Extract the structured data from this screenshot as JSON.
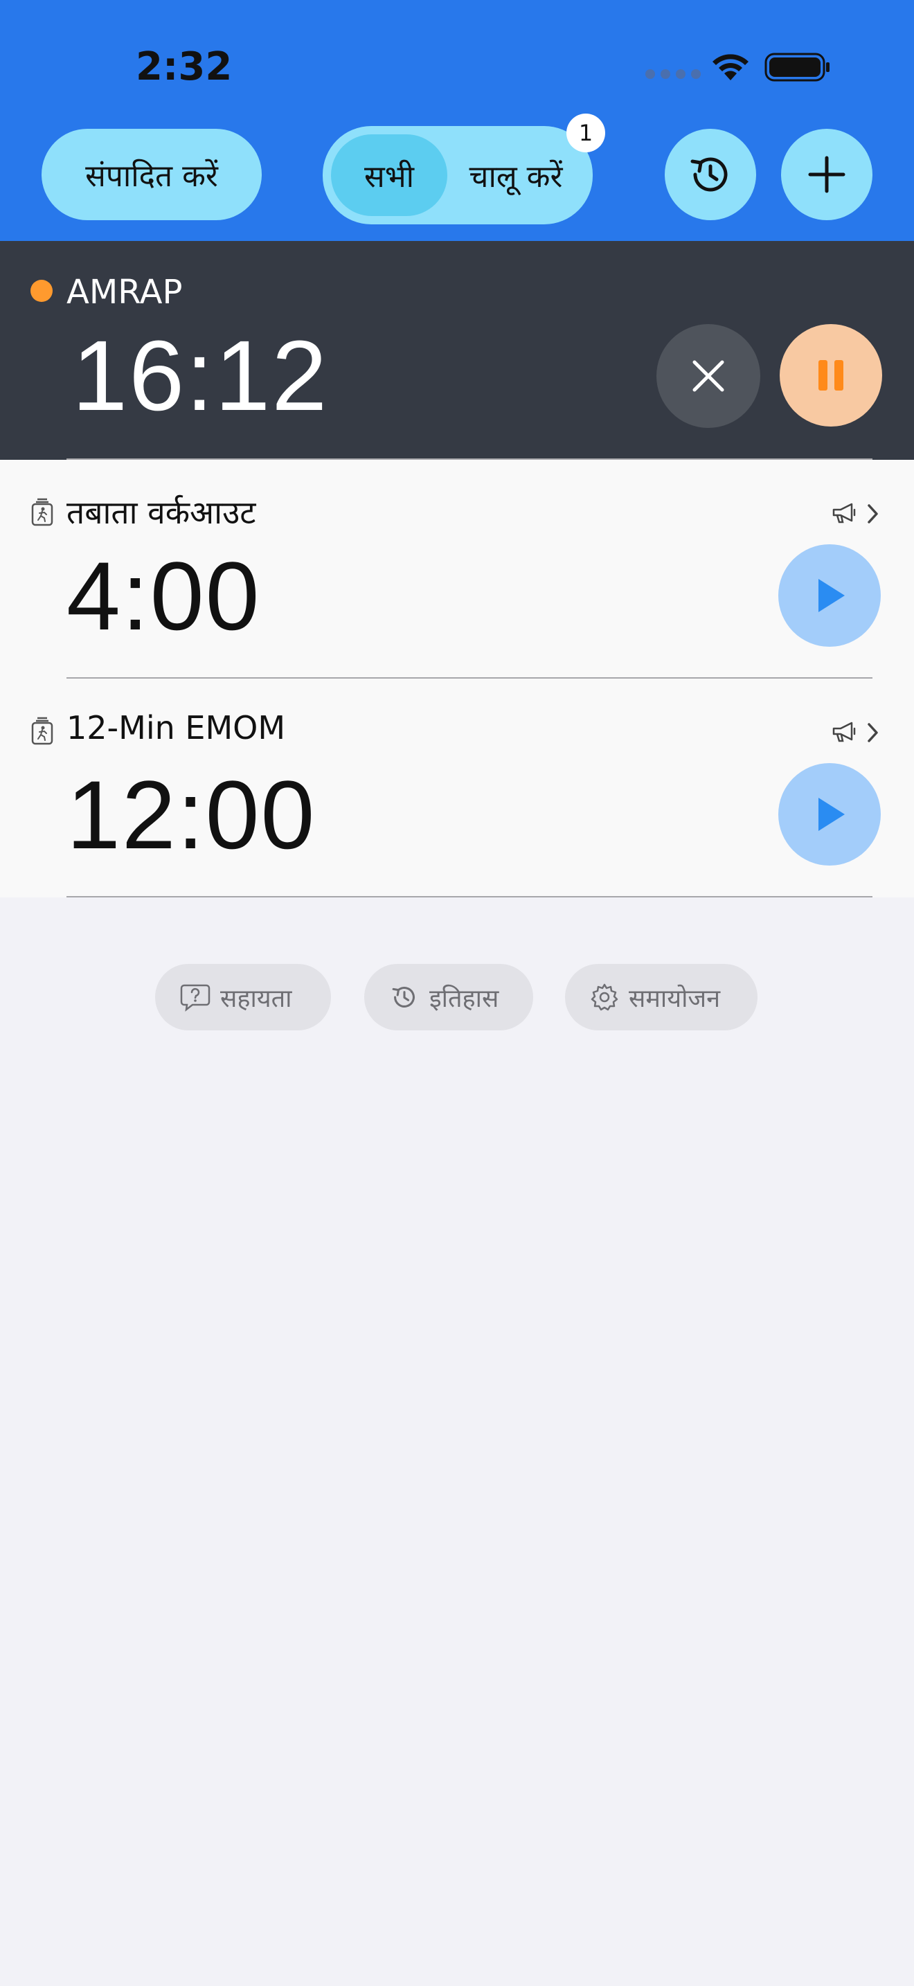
{
  "status_bar": {
    "time": "2:32"
  },
  "header": {
    "edit_label": "संपादित करें",
    "segment_all": "सभी",
    "segment_running": "चालू करें",
    "badge_count": "1",
    "history_icon": "history-icon",
    "add_icon": "plus-icon"
  },
  "running_timer": {
    "name": "AMRAP",
    "time": "16:12",
    "status_color": "#ff9a2e"
  },
  "timers": [
    {
      "name": "तबाता वर्कआउट",
      "time": "4:00"
    },
    {
      "name": "12-Min EMOM",
      "time": "12:00"
    }
  ],
  "footer": {
    "help": "सहायता",
    "history": "इतिहास",
    "settings": "समायोजन"
  },
  "colors": {
    "header_bg": "#2878eb",
    "pill_bg": "#8fe0fb",
    "running_bg": "#353a44",
    "pause_bg": "#f8c9a2",
    "play_bg": "#a3cdfa"
  }
}
